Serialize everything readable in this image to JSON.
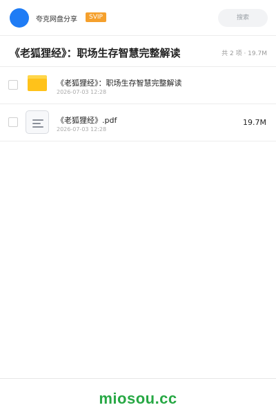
{
  "header": {
    "brand": "夸克网盘分享",
    "badge": "SVIP",
    "search_placeholder": "搜索"
  },
  "share": {
    "title": "《老狐狸经》：职场生存智慧完整解读",
    "summary": "共 2 项 · 19.7M"
  },
  "files": [
    {
      "name": "《老狐狸经》：职场生存智慧完整解读",
      "date": "2026-07-03 12:28",
      "size": "",
      "icon": "folder-icon"
    },
    {
      "name": "《老狐狸经》.pdf",
      "date": "2026-07-03 12:28",
      "size": "19.7M",
      "icon": "document-icon"
    }
  ],
  "footer": {
    "watermark": "miosou.cc"
  },
  "colors": {
    "accent": "#1f7cf5",
    "badge": "#f5a02c",
    "folder": "#ffc21a",
    "watermark": "#27a844"
  }
}
